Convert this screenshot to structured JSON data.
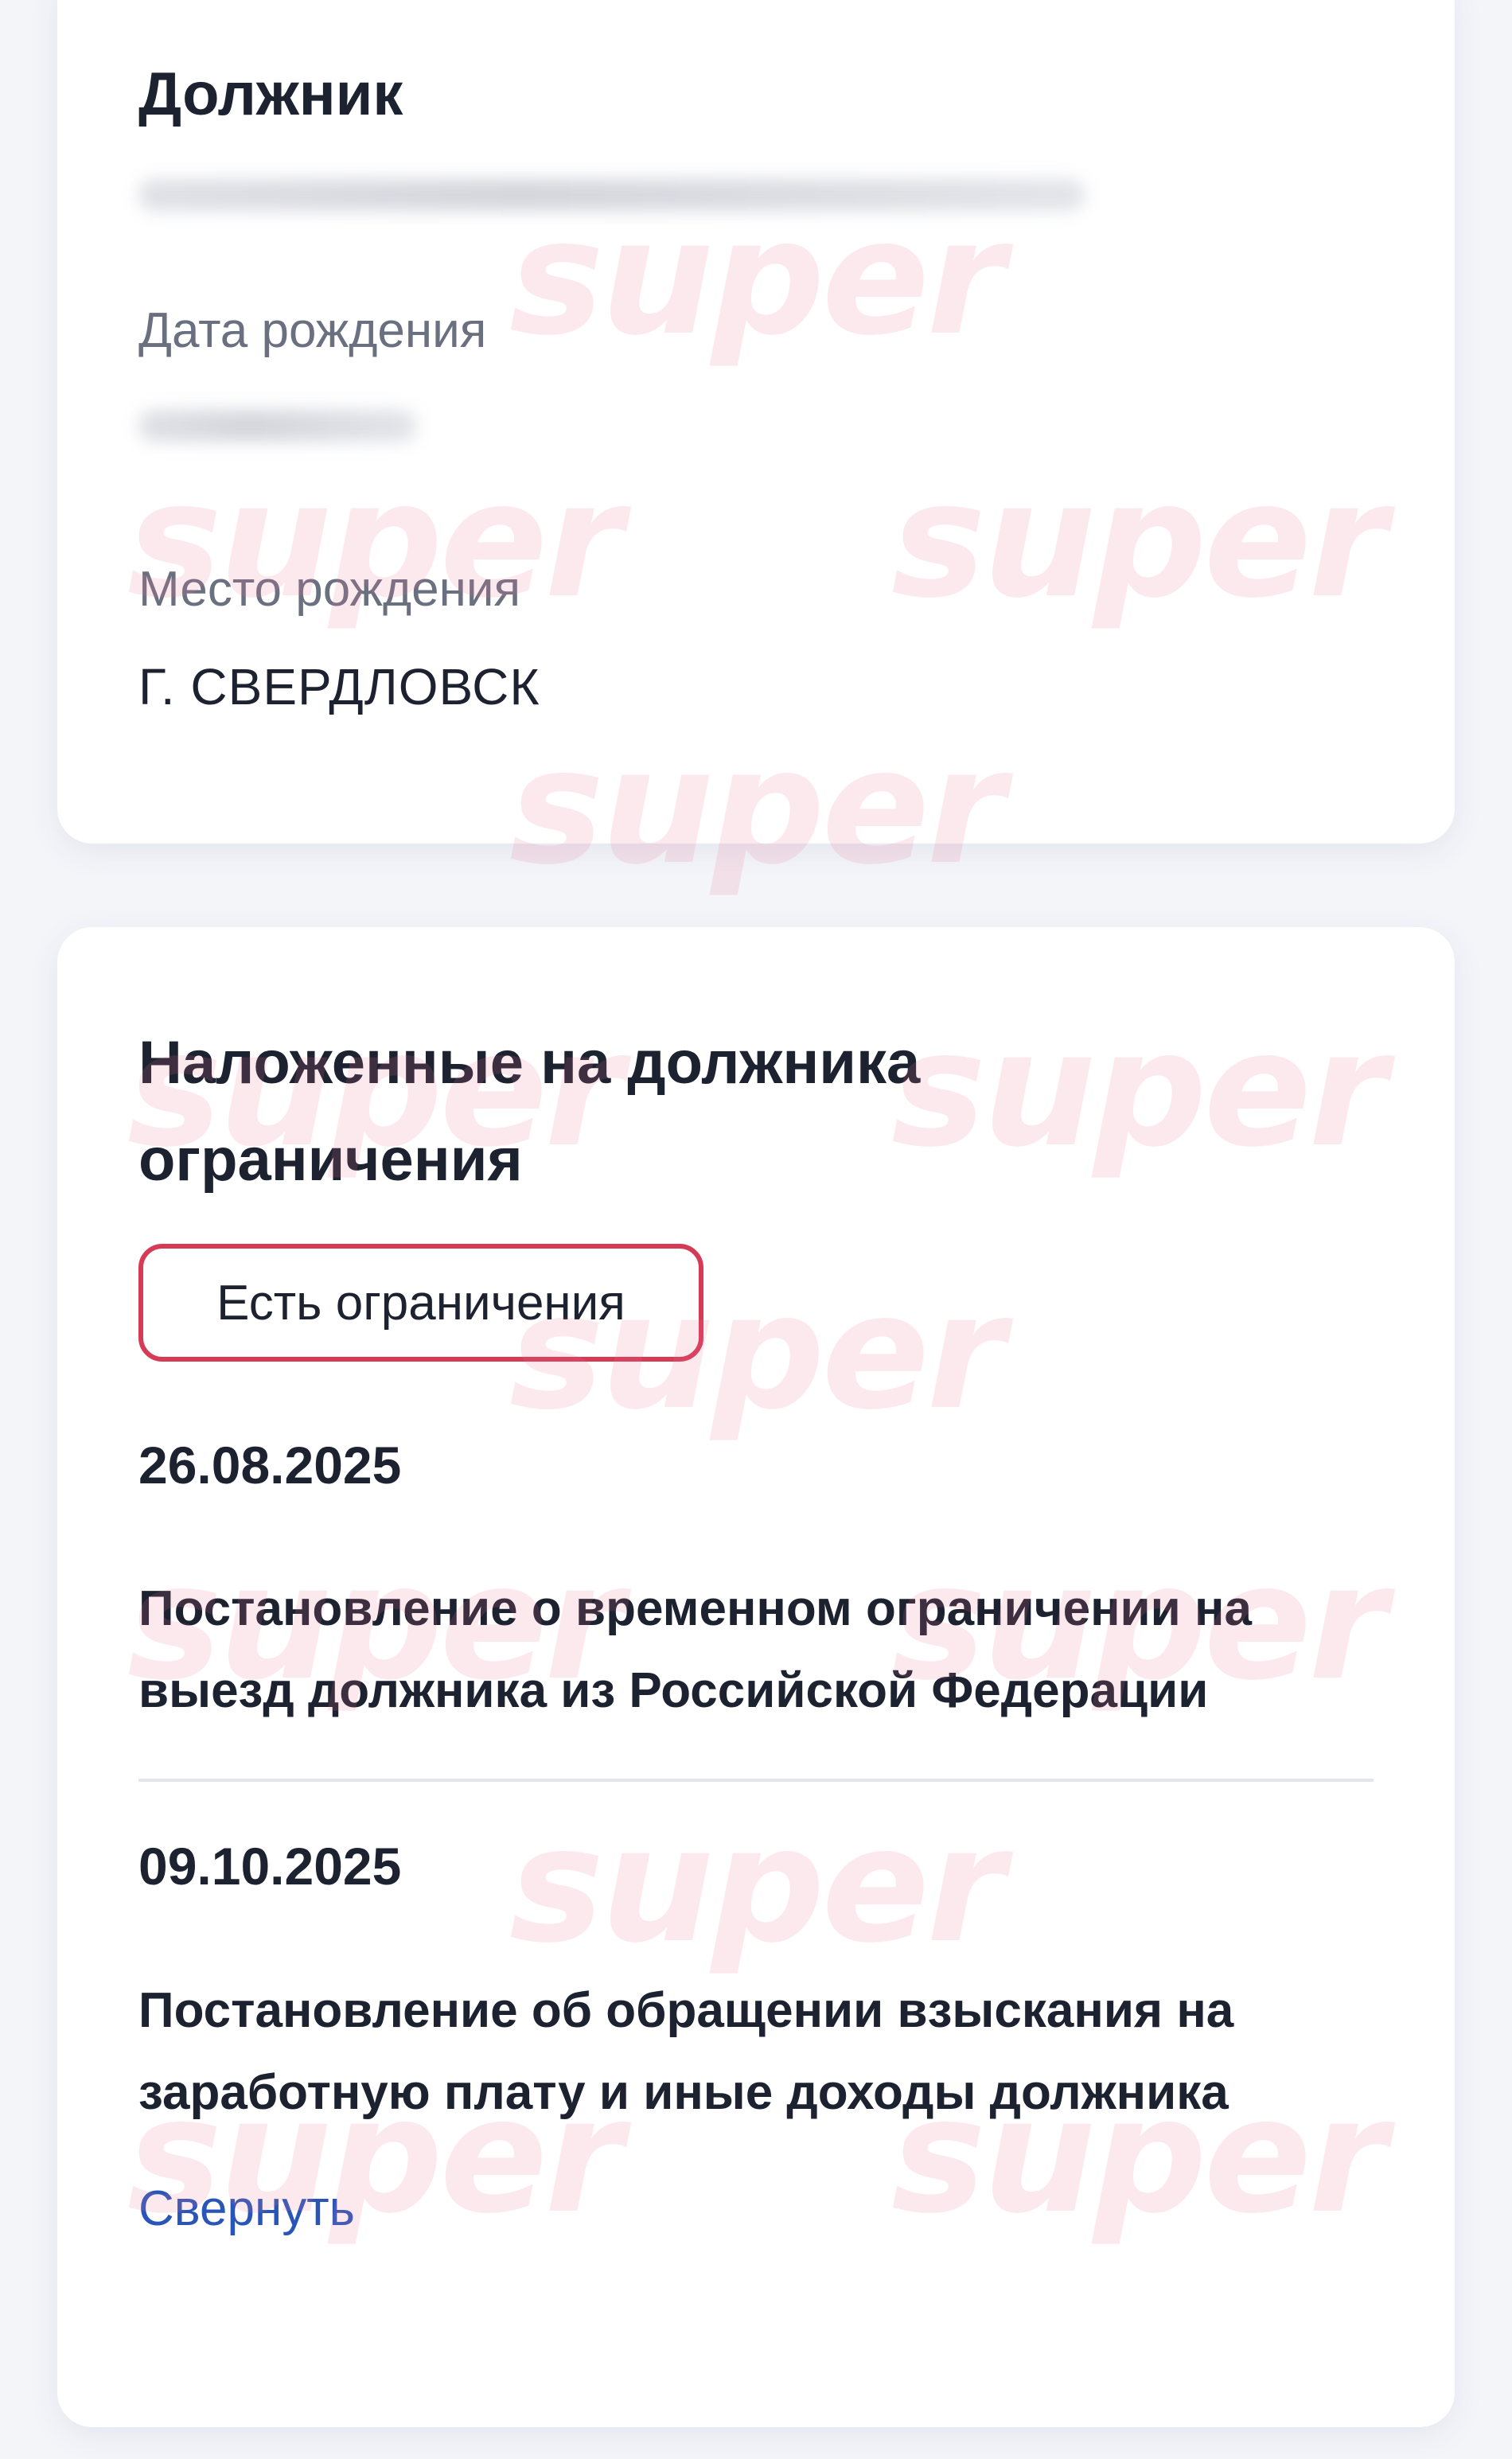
{
  "debtor_card": {
    "title": "Должник",
    "birth_date_label": "Дата рождения",
    "birth_place_label": "Место рождения",
    "birth_place_value": "Г. СВЕРДЛОВСК"
  },
  "restrictions_card": {
    "title_line1": "Наложенные на должника",
    "title_line2": "ограничения",
    "badge_label": "Есть ограничения",
    "items": [
      {
        "date": "26.08.2025",
        "title_line1": "Постановление о временном ограничении на",
        "title_line2": "выезд должника из Российской Федерации"
      },
      {
        "date": "09.10.2025",
        "title_line1": "Постановление об обращении взыскания на",
        "title_line2": "заработную плату и иные доходы должника"
      }
    ],
    "collapse_label": "Свернуть"
  },
  "watermark": {
    "text": "super"
  },
  "colors": {
    "badge_border": "#d63a55",
    "link": "#2a55b8",
    "background": "#f4f5f9"
  }
}
